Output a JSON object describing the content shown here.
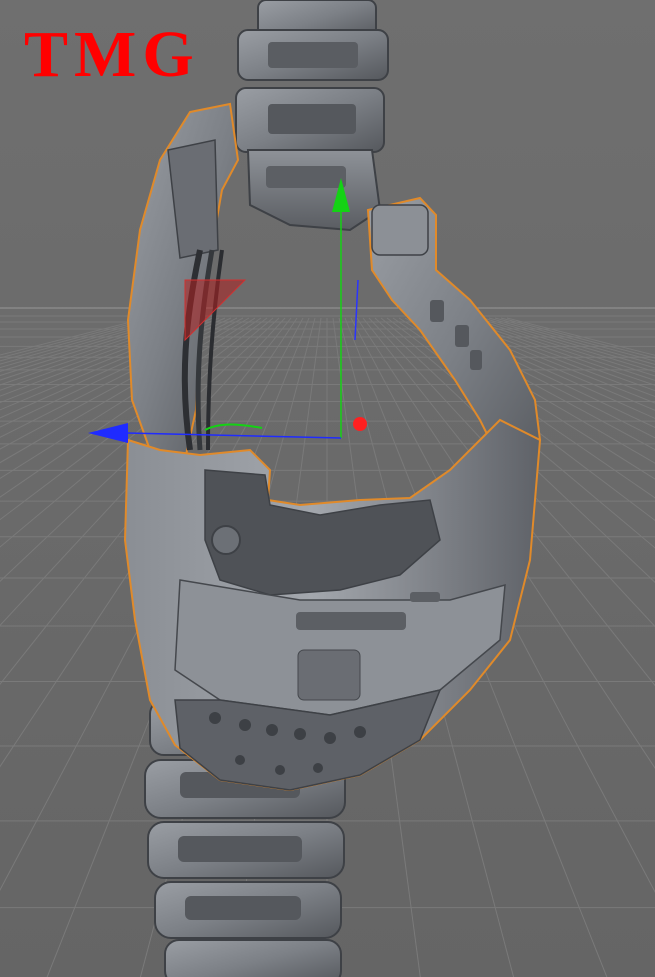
{
  "watermark": {
    "text": "TMG",
    "color": "#ff0000"
  },
  "viewport": {
    "background_top": "#6f6f6f",
    "background_bottom": "#666666",
    "grid_color": "#7a7a7a",
    "horizon_color": "#9a9a9a"
  },
  "gizmo": {
    "x_axis_color": "#1f2bff",
    "y_axis_color": "#14d214",
    "z_axis_color": "#2a34ff",
    "pivot_color": "#ff2020",
    "plane_handle_color": "#b02020"
  },
  "model": {
    "selection_outline_color": "#e08a2a",
    "body_color": "#7e8288",
    "shadow_color": "#4a4d52",
    "highlight_color": "#a6aab0"
  }
}
